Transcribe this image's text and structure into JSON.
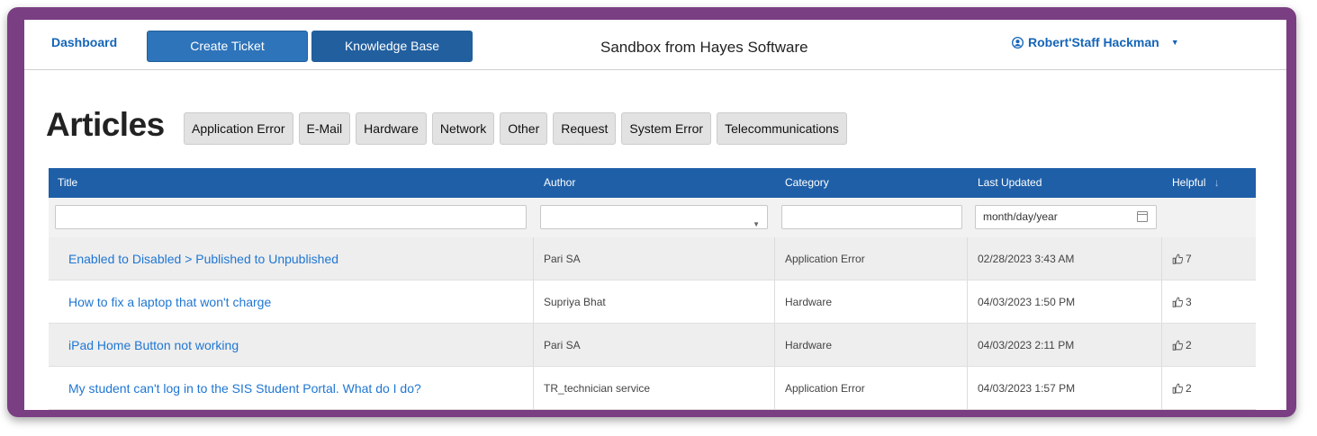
{
  "nav": {
    "dashboard": "Dashboard",
    "create_ticket": "Create Ticket",
    "knowledge_base": "Knowledge Base",
    "site_title": "Sandbox from Hayes Software",
    "user_name": "Robert'Staff Hackman",
    "user_icon": "user-circle-icon",
    "caret_icon": "caret-down-icon"
  },
  "page": {
    "title": "Articles",
    "categories": [
      "Application Error",
      "E-Mail",
      "Hardware",
      "Network",
      "Other",
      "Request",
      "System Error",
      "Telecommunications"
    ]
  },
  "table": {
    "columns": {
      "title": "Title",
      "author": "Author",
      "category": "Category",
      "last_updated": "Last Updated",
      "helpful": "Helpful"
    },
    "sort_icon": "arrow-down-icon",
    "filters": {
      "title_value": "",
      "author_value": "",
      "category_value": "",
      "date_placeholder": "month/day/year"
    },
    "rows": [
      {
        "title": "Enabled to Disabled > Published to Unpublished",
        "author": "Pari SA",
        "category": "Application Error",
        "updated": "02/28/2023 3:43 AM",
        "helpful": "7"
      },
      {
        "title": "How to fix a laptop that won't charge",
        "author": "Supriya Bhat",
        "category": "Hardware",
        "updated": "04/03/2023 1:50 PM",
        "helpful": "3"
      },
      {
        "title": "iPad Home Button not working",
        "author": "Pari SA",
        "category": "Hardware",
        "updated": "04/03/2023 2:11 PM",
        "helpful": "2"
      },
      {
        "title": "My student can't log in to the SIS Student Portal. What do I do?",
        "author": "TR_technician service",
        "category": "Application Error",
        "updated": "04/03/2023 1:57 PM",
        "helpful": "2"
      }
    ]
  },
  "colors": {
    "frame": "#7a3e82",
    "header_bar": "#1e5fa8",
    "link": "#1f76d2",
    "button": "#2d74ba"
  }
}
